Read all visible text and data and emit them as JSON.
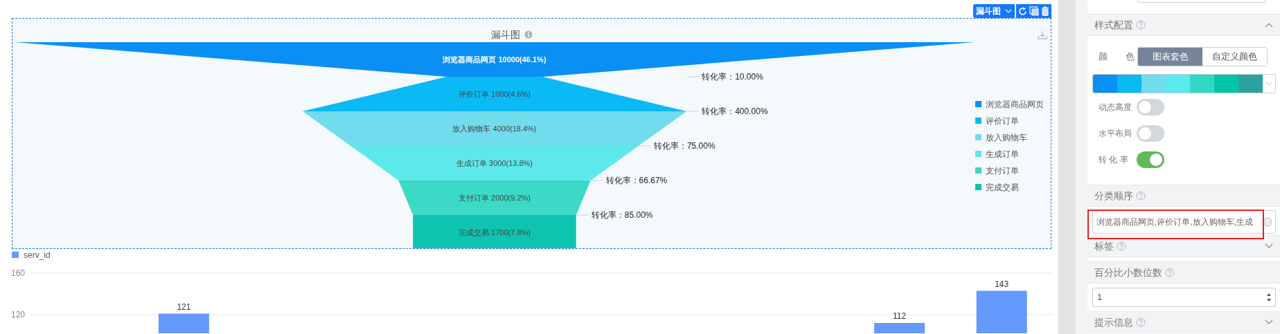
{
  "toolbar": {
    "chart_type": "漏斗图"
  },
  "funnel_chart": {
    "title": "漏斗图",
    "stages": [
      {
        "name": "浏览器商品网页",
        "value": "10000",
        "percent": "(46.1%)",
        "color": "#0a8ff5"
      },
      {
        "name": "评价订单",
        "value": "1000",
        "percent": "(4.6%)",
        "color": "#0abaf5"
      },
      {
        "name": "放入购物车",
        "value": "4000",
        "percent": "(18.4%)",
        "color": "#72dcef"
      },
      {
        "name": "生成订单",
        "value": "3000",
        "percent": "(13.8%)",
        "color": "#5de9ec"
      },
      {
        "name": "支付订单",
        "value": "2000",
        "percent": "(9.2%)",
        "color": "#3cd9c6"
      },
      {
        "name": "完成交易",
        "value": "1700",
        "percent": "(7.8%)",
        "color": "#0ec4b0"
      }
    ],
    "conversions": [
      "转化率：10.00%",
      "转化率：400.00%",
      "转化率：75.00%",
      "转化率：66.67%",
      "转化率：85.00%"
    ],
    "legend": [
      {
        "label": "浏览器商品网页",
        "color": "#0a8ff5"
      },
      {
        "label": "评价订单",
        "color": "#0abaf5"
      },
      {
        "label": "放入购物车",
        "color": "#72dcef"
      },
      {
        "label": "生成订单",
        "color": "#5de9ec"
      },
      {
        "label": "支付订单",
        "color": "#3cd9c6"
      },
      {
        "label": "完成交易",
        "color": "#0ec4b0"
      }
    ]
  },
  "bar_chart": {
    "chart_data": {
      "type": "bar",
      "yticks": [
        120,
        160
      ],
      "ylim": [
        102,
        160
      ],
      "data_labels": true,
      "series": [
        {
          "name": "serv_id",
          "color": "#6599fd",
          "values": [
            null,
            121,
            null,
            null,
            null,
            null,
            null,
            null,
            112,
            143
          ]
        }
      ]
    }
  },
  "settings_panel": {
    "style_section": {
      "title": "样式配置",
      "expanded": true,
      "color_label": "颜 色",
      "palette_modes": [
        {
          "label": "图表套色",
          "selected": true
        },
        {
          "label": "自定义颜色",
          "selected": false
        }
      ],
      "palette": [
        {
          "color": "#0a8ff5"
        },
        {
          "color": "#08b9f2"
        },
        {
          "color": "#72dcef"
        },
        {
          "color": "#5ae9ec"
        },
        {
          "color": "#30d9c2"
        },
        {
          "color": "#00c4a8"
        },
        {
          "color": "#2aa3a0"
        }
      ],
      "switches": [
        {
          "label": "动态高度",
          "on": false
        },
        {
          "label": "水平布局",
          "on": false
        },
        {
          "label": "转 化 率",
          "on": true
        }
      ]
    },
    "category_order": {
      "title": "分类顺序",
      "value": "浏览器商品网页,评价订单,放入购物车,生成",
      "highlighted": true
    },
    "label_section": {
      "title": "标签",
      "expanded": false
    },
    "decimal_places": {
      "title": "百分比小数位数",
      "value": "1"
    },
    "tooltip_section": {
      "title": "提示信息",
      "expanded": false
    }
  }
}
